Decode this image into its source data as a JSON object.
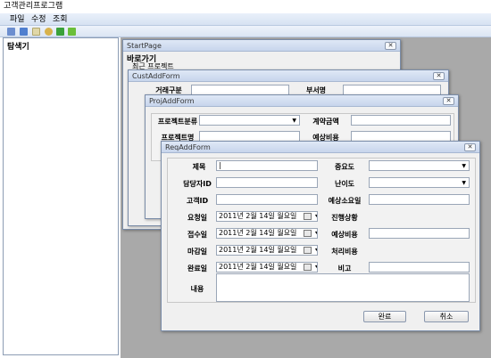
{
  "app": {
    "title": "고객관리프로그램"
  },
  "menu": [
    "파일",
    "수정",
    "조회"
  ],
  "toolbar": {
    "icons": [
      "open-folder-icon",
      "save-icon",
      "document-icon",
      "search-icon",
      "forward-arrow-icon",
      "check-arrow-icon"
    ],
    "colors": [
      "#6c8ecf",
      "#4f7fcf",
      "#e0d7a8",
      "#d8b24c",
      "#3aa13a",
      "#6bbf3a"
    ]
  },
  "explorer": {
    "title": "탐색기"
  },
  "start_page": {
    "title": "StartPage",
    "heading": "바로가기",
    "subheading": "최근 프로젝트"
  },
  "cust_form": {
    "title": "CustAddForm",
    "label1": "거래구분",
    "label2": "부서명"
  },
  "proj_form": {
    "title": "ProjAddForm",
    "label_category": "프로젝트분류",
    "label_name": "프로젝트명",
    "label_amount": "계약금액",
    "label_cost": "예상비용"
  },
  "req_form": {
    "title": "ReqAddForm",
    "labels": {
      "subject": "제목",
      "importance": "중요도",
      "owner_id": "담당자ID",
      "difficulty": "난이도",
      "customer_id": "고객ID",
      "estimated_days": "예상소요일",
      "request_date": "요청일",
      "progress": "진행상황",
      "receipt_date": "접수일",
      "estimated_cost": "예상비용",
      "due_date": "마감일",
      "processing_cost": "처리비용",
      "completion_date": "완료일",
      "note": "비고",
      "content": "내용"
    },
    "values": {
      "subject": "|",
      "request_date": "2011년  2월 14일 월요일",
      "receipt_date": "2011년  2월 14일 월요일",
      "due_date": "2011년  2월 14일 월요일",
      "completion_date": "2011년  2월 14일 월요일"
    },
    "buttons": {
      "ok": "완료",
      "cancel": "취소"
    }
  },
  "colors": {
    "mdi_background": "#a9a9a9",
    "caption_gradient_top": "#dfe8f6",
    "caption_gradient_bottom": "#c7d5ec"
  }
}
